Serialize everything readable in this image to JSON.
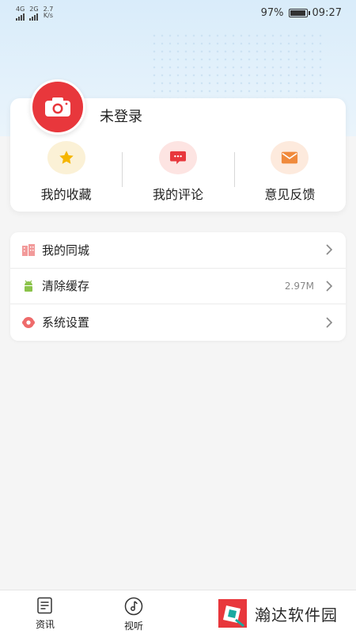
{
  "status_bar": {
    "signal1_label": "4G",
    "signal2_label": "2G",
    "net_speed_value": "2.7",
    "net_speed_unit": "K/s",
    "battery_percent": "97%",
    "battery_level": 0.97,
    "time": "09:27"
  },
  "profile": {
    "login_status": "未登录",
    "avatar_icon": "camera-icon",
    "quick_actions": [
      {
        "label": "我的收藏",
        "icon": "star-icon",
        "bg": "#fbf1d6",
        "color": "#f5b500"
      },
      {
        "label": "我的评论",
        "icon": "comment-icon",
        "bg": "#fde4e2",
        "color": "#e8373c"
      },
      {
        "label": "意见反馈",
        "icon": "mail-icon",
        "bg": "#fdeadd",
        "color": "#f08a3c"
      }
    ]
  },
  "menu": {
    "items": [
      {
        "label": "我的同城",
        "icon": "city-icon",
        "value": ""
      },
      {
        "label": "清除缓存",
        "icon": "android-icon",
        "value": "2.97M"
      },
      {
        "label": "系统设置",
        "icon": "settings-icon",
        "value": ""
      }
    ]
  },
  "bottom_nav": {
    "items": [
      {
        "label": "资讯",
        "icon": "news-icon"
      },
      {
        "label": "视听",
        "icon": "music-icon"
      }
    ]
  },
  "watermark": {
    "text": "瀚达软件园"
  },
  "colors": {
    "accent_red": "#e8373c",
    "header_blue": "#d9ecfa"
  }
}
